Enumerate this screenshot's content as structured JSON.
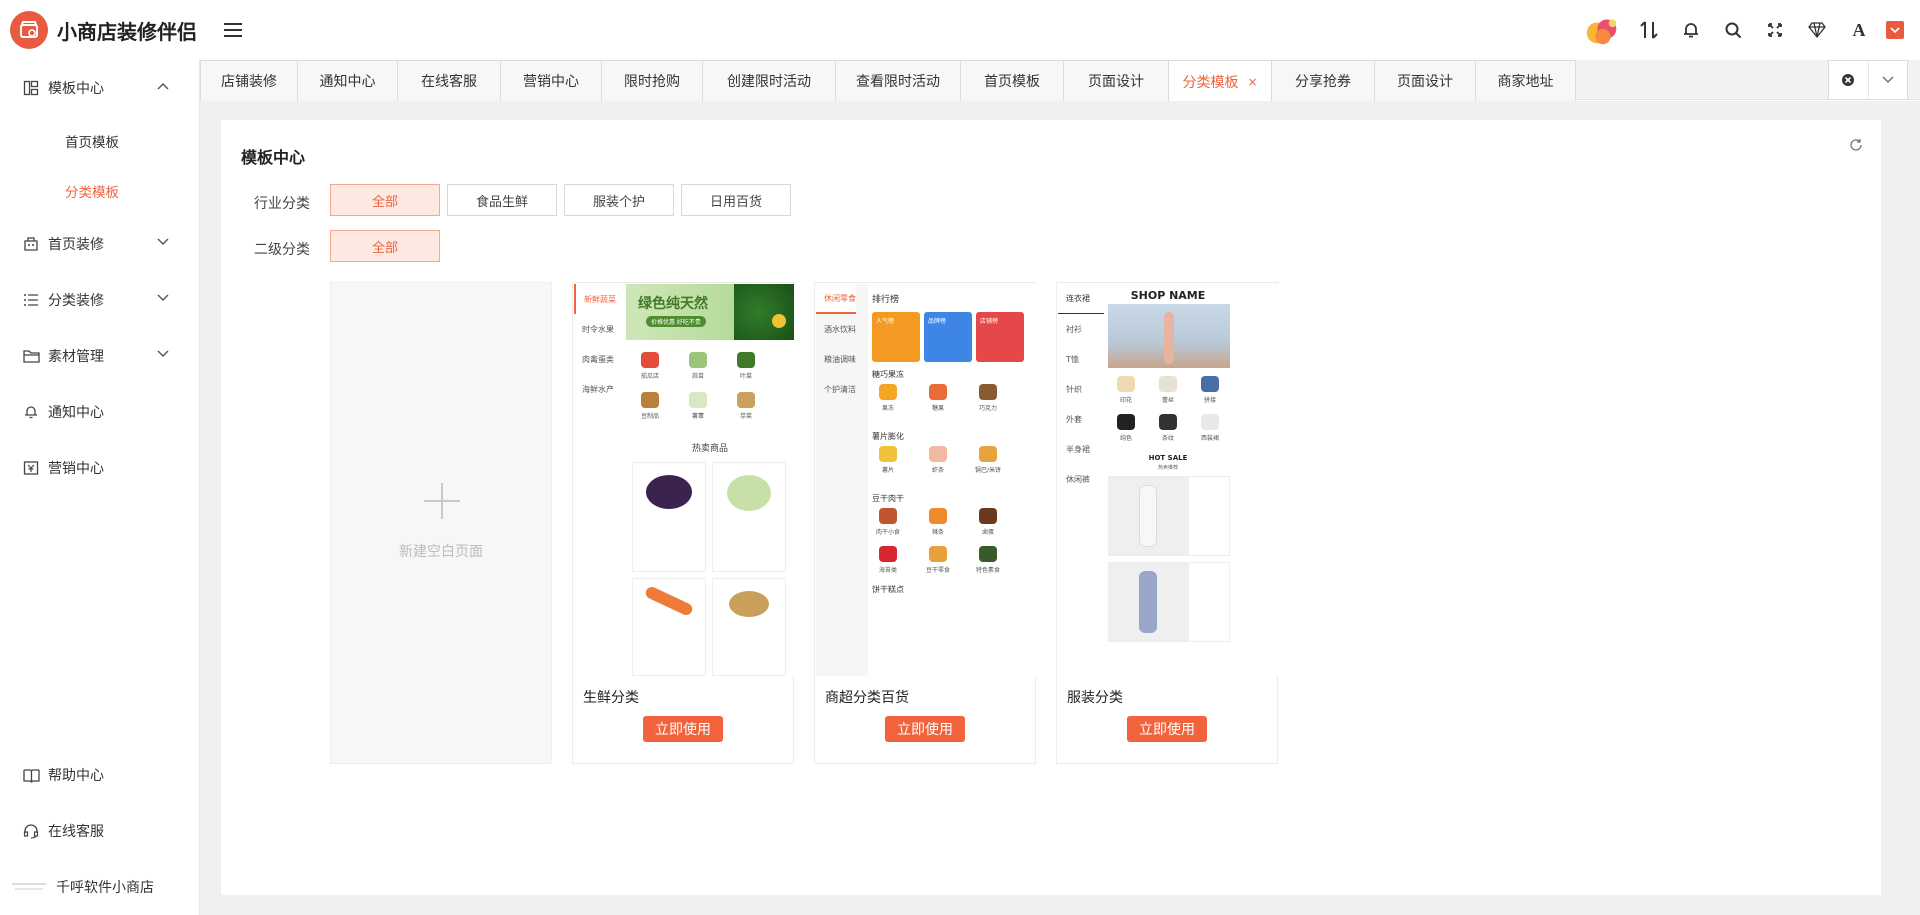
{
  "app": {
    "title": "小商店装修伴侣"
  },
  "sidebar": {
    "items": [
      {
        "label": "模板中心",
        "icon": "template-icon",
        "expanded": true,
        "children": [
          {
            "label": "首页模板"
          },
          {
            "label": "分类模板",
            "active": true
          }
        ]
      },
      {
        "label": "首页装修",
        "icon": "palette-icon"
      },
      {
        "label": "分类装修",
        "icon": "list-icon"
      },
      {
        "label": "素材管理",
        "icon": "folder-icon"
      },
      {
        "label": "通知中心",
        "icon": "bell-icon"
      },
      {
        "label": "营销中心",
        "icon": "yen-icon"
      }
    ],
    "bottom": [
      {
        "label": "帮助中心",
        "icon": "book-icon"
      },
      {
        "label": "在线客服",
        "icon": "headset-icon"
      }
    ],
    "shop": {
      "label": "千呼软件小商店"
    }
  },
  "tabs": [
    {
      "label": "店铺装修"
    },
    {
      "label": "通知中心"
    },
    {
      "label": "在线客服"
    },
    {
      "label": "营销中心"
    },
    {
      "label": "限时抢购"
    },
    {
      "label": "创建限时活动"
    },
    {
      "label": "查看限时活动"
    },
    {
      "label": "首页模板"
    },
    {
      "label": "页面设计"
    },
    {
      "label": "分类模板",
      "active": true,
      "close": "×"
    },
    {
      "label": "分享抢券"
    },
    {
      "label": "页面设计"
    },
    {
      "label": "商家地址"
    }
  ],
  "page": {
    "title": "模板中心",
    "filters": {
      "industry": {
        "label": "行业分类",
        "options": [
          "全部",
          "食品生鲜",
          "服装个护",
          "日用百货"
        ],
        "selected": "全部"
      },
      "secondary": {
        "label": "二级分类",
        "options": [
          "全部"
        ],
        "selected": "全部"
      }
    },
    "blank": {
      "label": "新建空白页面"
    },
    "templates": [
      {
        "name": "生鲜分类",
        "button": "立即使用",
        "preview": {
          "side": [
            "新鲜蔬菜",
            "时令水果",
            "肉禽蛋类",
            "海鲜水产"
          ],
          "banner": "绿色纯天然",
          "banner_sub": "价格优惠 好吃不贵",
          "icons": [
            "茄瓜店",
            "蒜苗",
            "叶菜",
            "豆制品",
            "薯蕈",
            "芽菜"
          ],
          "section": "热卖商品"
        }
      },
      {
        "name": "商超分类百货",
        "button": "立即使用",
        "preview": {
          "side": [
            "休闲零食",
            "酒水饮料",
            "粮油调味",
            "个护清洁"
          ],
          "rank": "排行榜",
          "rank_cards": [
            "人气榜",
            "品牌榜",
            "店铺榜"
          ],
          "groups": [
            {
              "title": "糖巧果冻",
              "items": [
                "果冻",
                "糖果",
                "巧克力"
              ]
            },
            {
              "title": "薯片膨化",
              "items": [
                "薯片",
                "虾条",
                "锅巴/米饼"
              ]
            },
            {
              "title": "豆干肉干",
              "items": [
                "肉干小食",
                "辣条",
                "卤蛋"
              ]
            },
            {
              "title": "",
              "items": [
                "海苔类",
                "豆干零食",
                "特色素食"
              ]
            }
          ],
          "footer": "饼干糕点"
        }
      },
      {
        "name": "服装分类",
        "button": "立即使用",
        "preview": {
          "side": [
            "连衣裙",
            "衬衫",
            "T恤",
            "针织",
            "外套",
            "半身裙",
            "休闲裤"
          ],
          "shop_name": "SHOP NAME",
          "items": [
            "印花",
            "蕾丝",
            "拼接",
            "纯色",
            "条纹",
            "西装裙"
          ],
          "hot": "HOT SALE",
          "hot_sub": "热卖推荐"
        }
      }
    ]
  },
  "colors": {
    "accent": "#f0633d",
    "accent_light": "#fde8e2"
  }
}
